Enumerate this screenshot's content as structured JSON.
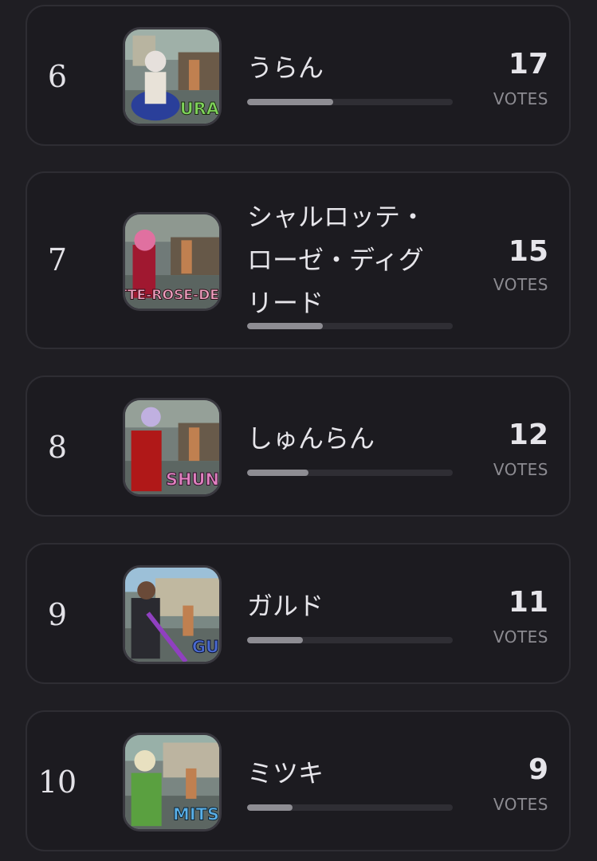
{
  "votes_label": "VOTES",
  "entries": [
    {
      "rank": "6",
      "name": "うらん",
      "votes": "17",
      "share": 0.42,
      "thumb_caption": "URA",
      "caption_color": "#7fd35a"
    },
    {
      "rank": "7",
      "name": "シャルロッテ・\nローゼ・ディグ\nリード",
      "votes": "15",
      "share": 0.37,
      "thumb_caption": "OTTE-ROSE-DE",
      "caption_color": "#f0a0c0"
    },
    {
      "rank": "8",
      "name": "しゅんらん",
      "votes": "12",
      "share": 0.3,
      "thumb_caption": "SHUN",
      "caption_color": "#e080c0"
    },
    {
      "rank": "9",
      "name": "ガルド",
      "votes": "11",
      "share": 0.27,
      "thumb_caption": "GU",
      "caption_color": "#4a6ad0"
    },
    {
      "rank": "10",
      "name": "ミツキ",
      "votes": "9",
      "share": 0.22,
      "thumb_caption": "MITS",
      "caption_color": "#5ab0e8"
    }
  ]
}
